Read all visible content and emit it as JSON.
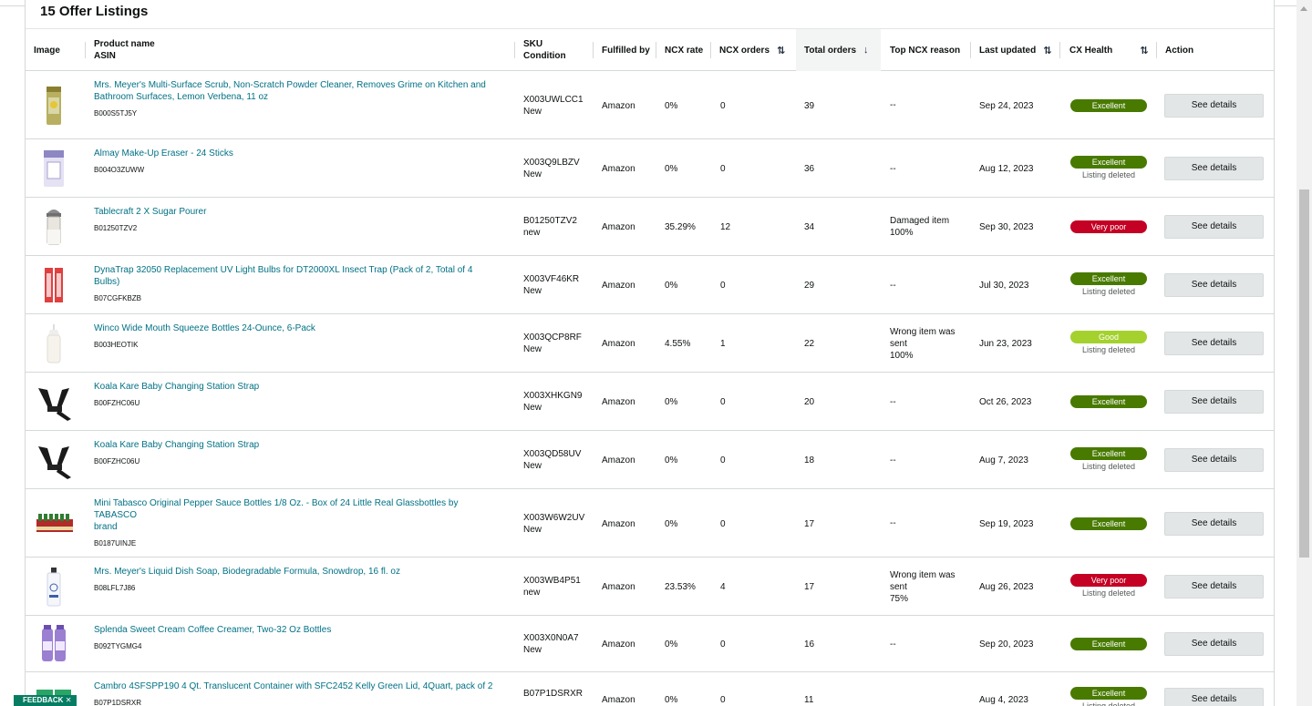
{
  "title": "15 Offer Listings",
  "columns": {
    "image": "Image",
    "product_name": "Product name",
    "asin": "ASIN",
    "sku": "SKU",
    "condition": "Condition",
    "fulfilled_by": "Fulfilled by",
    "ncx_rate": "NCX rate",
    "ncx_orders": "NCX orders",
    "total_orders": "Total orders",
    "top_ncx_reason": "Top NCX reason",
    "last_updated": "Last updated",
    "cx_health": "CX Health",
    "action": "Action"
  },
  "rows": [
    {
      "name_line1": "Mrs. Meyer's Multi-Surface Scrub, Non-Scratch Powder Cleaner, Removes Grime on Kitchen and",
      "name_line2": "Bathroom Surfaces, Lemon Verbena, 11 oz",
      "asin": "B000S5TJ5Y",
      "sku": "X003UWLCC1",
      "condition": "New",
      "fulfilled": "Amazon",
      "ncx_rate": "0%",
      "ncx_orders": "0",
      "total": "39",
      "reason1": "--",
      "reason2": "",
      "reason3": "",
      "updated": "Sep 24, 2023",
      "health": "Excellent",
      "health_color": "#487a00",
      "status": "",
      "action": "See details",
      "image": "cleaner-canister"
    },
    {
      "name_line1": "Almay Make-Up Eraser - 24 Sticks",
      "name_line2": "",
      "asin": "B004O3ZUWW",
      "sku": "X003Q9LBZV",
      "condition": "New",
      "fulfilled": "Amazon",
      "ncx_rate": "0%",
      "ncx_orders": "0",
      "total": "36",
      "reason1": "--",
      "reason2": "",
      "reason3": "",
      "updated": "Aug 12, 2023",
      "health": "Excellent",
      "health_color": "#487a00",
      "status": "Listing deleted",
      "action": "See details",
      "image": "makeup-box"
    },
    {
      "name_line1": "Tablecraft 2 X Sugar Pourer",
      "name_line2": "",
      "asin": "B01250TZV2",
      "sku": "B01250TZV2",
      "condition": "new",
      "fulfilled": "Amazon",
      "ncx_rate": "35.29%",
      "ncx_orders": "12",
      "total": "34",
      "reason1": "Damaged item",
      "reason2": "100%",
      "reason3": "",
      "updated": "Sep 30, 2023",
      "health": "Very poor",
      "health_color": "#c40024",
      "status": "",
      "action": "See details",
      "image": "sugar-pourer"
    },
    {
      "name_line1": "DynaTrap 32050 Replacement UV Light Bulbs for DT2000XL Insect Trap (Pack of 2, Total of 4 Bulbs)",
      "name_line2": "",
      "asin": "B07CGFKBZB",
      "sku": "X003VF46KR",
      "condition": "New",
      "fulfilled": "Amazon",
      "ncx_rate": "0%",
      "ncx_orders": "0",
      "total": "29",
      "reason1": "--",
      "reason2": "",
      "reason3": "",
      "updated": "Jul 30, 2023",
      "health": "Excellent",
      "health_color": "#487a00",
      "status": "Listing deleted",
      "action": "See details",
      "image": "uv-bulbs"
    },
    {
      "name_line1": "Winco Wide Mouth Squeeze Bottles 24-Ounce, 6-Pack",
      "name_line2": "",
      "asin": "B003HEOTIK",
      "sku": "X003QCP8RF",
      "condition": "New",
      "fulfilled": "Amazon",
      "ncx_rate": "4.55%",
      "ncx_orders": "1",
      "total": "22",
      "reason1": "Wrong item was",
      "reason2": "sent",
      "reason3": "100%",
      "updated": "Jun 23, 2023",
      "health": "Good",
      "health_color": "#a4d12e",
      "status": "Listing deleted",
      "action": "See details",
      "image": "squeeze-bottle"
    },
    {
      "name_line1": "Koala Kare Baby Changing Station Strap",
      "name_line2": "",
      "asin": "B00FZHC06U",
      "sku": "X003XHKGN9",
      "condition": "New",
      "fulfilled": "Amazon",
      "ncx_rate": "0%",
      "ncx_orders": "0",
      "total": "20",
      "reason1": "--",
      "reason2": "",
      "reason3": "",
      "updated": "Oct 26, 2023",
      "health": "Excellent",
      "health_color": "#487a00",
      "status": "",
      "action": "See details",
      "image": "strap"
    },
    {
      "name_line1": "Koala Kare Baby Changing Station Strap",
      "name_line2": "",
      "asin": "B00FZHC06U",
      "sku": "X003QD58UV",
      "condition": "New",
      "fulfilled": "Amazon",
      "ncx_rate": "0%",
      "ncx_orders": "0",
      "total": "18",
      "reason1": "--",
      "reason2": "",
      "reason3": "",
      "updated": "Aug 7, 2023",
      "health": "Excellent",
      "health_color": "#487a00",
      "status": "Listing deleted",
      "action": "See details",
      "image": "strap"
    },
    {
      "name_line1": "Mini Tabasco Original Pepper Sauce Bottles 1/8 Oz. - Box of 24 Little Real Glassbottles by TABASCO",
      "name_line2": "brand",
      "asin": "B0187UINJE",
      "sku": "X003W6W2UV",
      "condition": "New",
      "fulfilled": "Amazon",
      "ncx_rate": "0%",
      "ncx_orders": "0",
      "total": "17",
      "reason1": "--",
      "reason2": "",
      "reason3": "",
      "updated": "Sep 19, 2023",
      "health": "Excellent",
      "health_color": "#487a00",
      "status": "",
      "action": "See details",
      "image": "tabasco-box"
    },
    {
      "name_line1": "Mrs. Meyer's Liquid Dish Soap, Biodegradable Formula, Snowdrop, 16 fl. oz",
      "name_line2": "",
      "asin": "B08LFL7J86",
      "sku": "X003WB4P51",
      "condition": "new",
      "fulfilled": "Amazon",
      "ncx_rate": "23.53%",
      "ncx_orders": "4",
      "total": "17",
      "reason1": "Wrong item was",
      "reason2": "sent",
      "reason3": "75%",
      "updated": "Aug 26, 2023",
      "health": "Very poor",
      "health_color": "#c40024",
      "status": "Listing deleted",
      "action": "See details",
      "image": "soap-bottle"
    },
    {
      "name_line1": "Splenda Sweet Cream Coffee Creamer, Two-32 Oz Bottles",
      "name_line2": "",
      "asin": "B092TYGMG4",
      "sku": "X003X0N0A7",
      "condition": "New",
      "fulfilled": "Amazon",
      "ncx_rate": "0%",
      "ncx_orders": "0",
      "total": "16",
      "reason1": "--",
      "reason2": "",
      "reason3": "",
      "updated": "Sep 20, 2023",
      "health": "Excellent",
      "health_color": "#487a00",
      "status": "",
      "action": "See details",
      "image": "creamer-bottles"
    },
    {
      "name_line1": "Cambro 4SFSPP190 4 Qt. Translucent Container with SFC2452 Kelly Green Lid, 4Quart, pack of 2",
      "name_line2": "",
      "asin": "B07P1DSRXR",
      "sku": "B07P1DSRXR",
      "condition": "",
      "fulfilled": "Amazon",
      "ncx_rate": "0%",
      "ncx_orders": "0",
      "total": "11",
      "reason1": "",
      "reason2": "",
      "reason3": "",
      "updated": "Aug 4, 2023",
      "health": "Excellent",
      "health_color": "#487a00",
      "status": "Listing deleted",
      "action": "See details",
      "image": "container"
    }
  ],
  "feedback": {
    "label": "FEEDBACK",
    "close": "✕"
  },
  "sort_icons": {
    "up_down": "⇅",
    "down": "↓"
  }
}
